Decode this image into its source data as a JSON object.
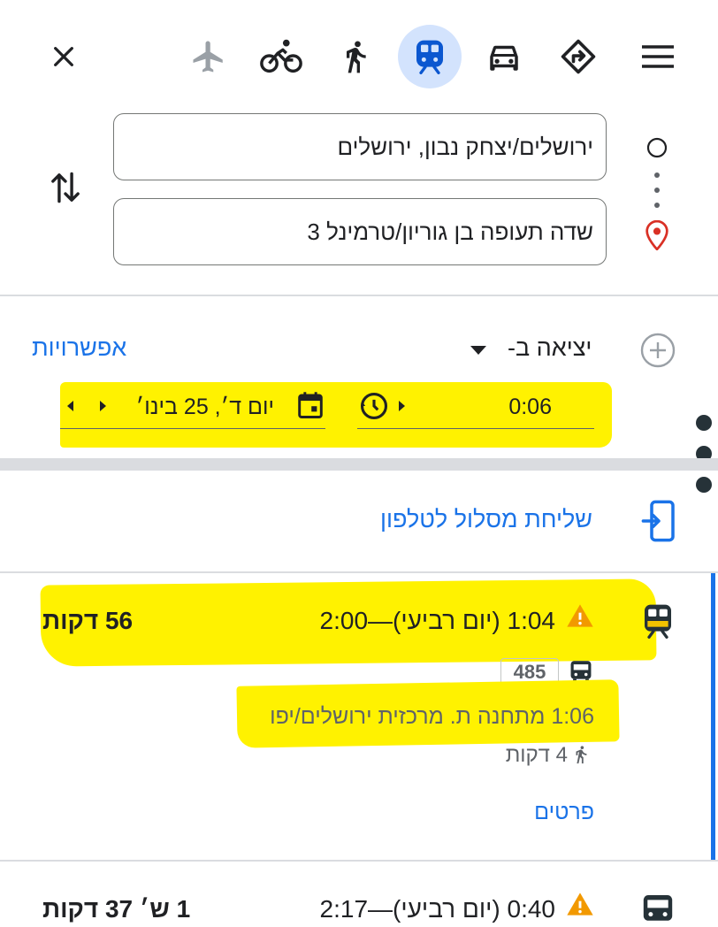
{
  "modes": [
    {
      "name": "close",
      "icon": "close-icon"
    },
    {
      "name": "flights",
      "icon": "airplane-icon"
    },
    {
      "name": "cycling",
      "icon": "bicycle-icon"
    },
    {
      "name": "walking",
      "icon": "walking-icon"
    },
    {
      "name": "transit",
      "icon": "train-icon",
      "selected": true
    },
    {
      "name": "driving",
      "icon": "car-icon"
    },
    {
      "name": "directions",
      "icon": "directions-icon"
    },
    {
      "name": "menu",
      "icon": "menu-icon"
    }
  ],
  "route": {
    "origin": "ירושלים/יצחק נבון, ירושלים",
    "destination": "שדה תעופה בן גוריון/טרמינל 3"
  },
  "options": {
    "depart_label": "יציאה ב-",
    "options_link": "אפשרויות",
    "date_value": "יום ד׳, 25 בינו׳",
    "time_value": "0:06"
  },
  "send_to_phone": "שליחת מסלול לטלפון",
  "results": [
    {
      "times": "1:04 (יום רביעי)—2:00",
      "duration": "56 דקות",
      "bus_number": "485",
      "departure": "1:06 מתחנה ת. מרכזית ירושלים/יפו",
      "walk": "4 דקות",
      "details": "פרטים"
    },
    {
      "times": "0:40 (יום רביעי)—2:17",
      "duration": "1 ש׳ 37 דקות"
    }
  ],
  "colors": {
    "accent": "#1a73e8",
    "highlight": "#fff200",
    "warning": "#f29900",
    "transit_selected_bg": "#d3e3fd",
    "destination_pin": "#d93025"
  }
}
